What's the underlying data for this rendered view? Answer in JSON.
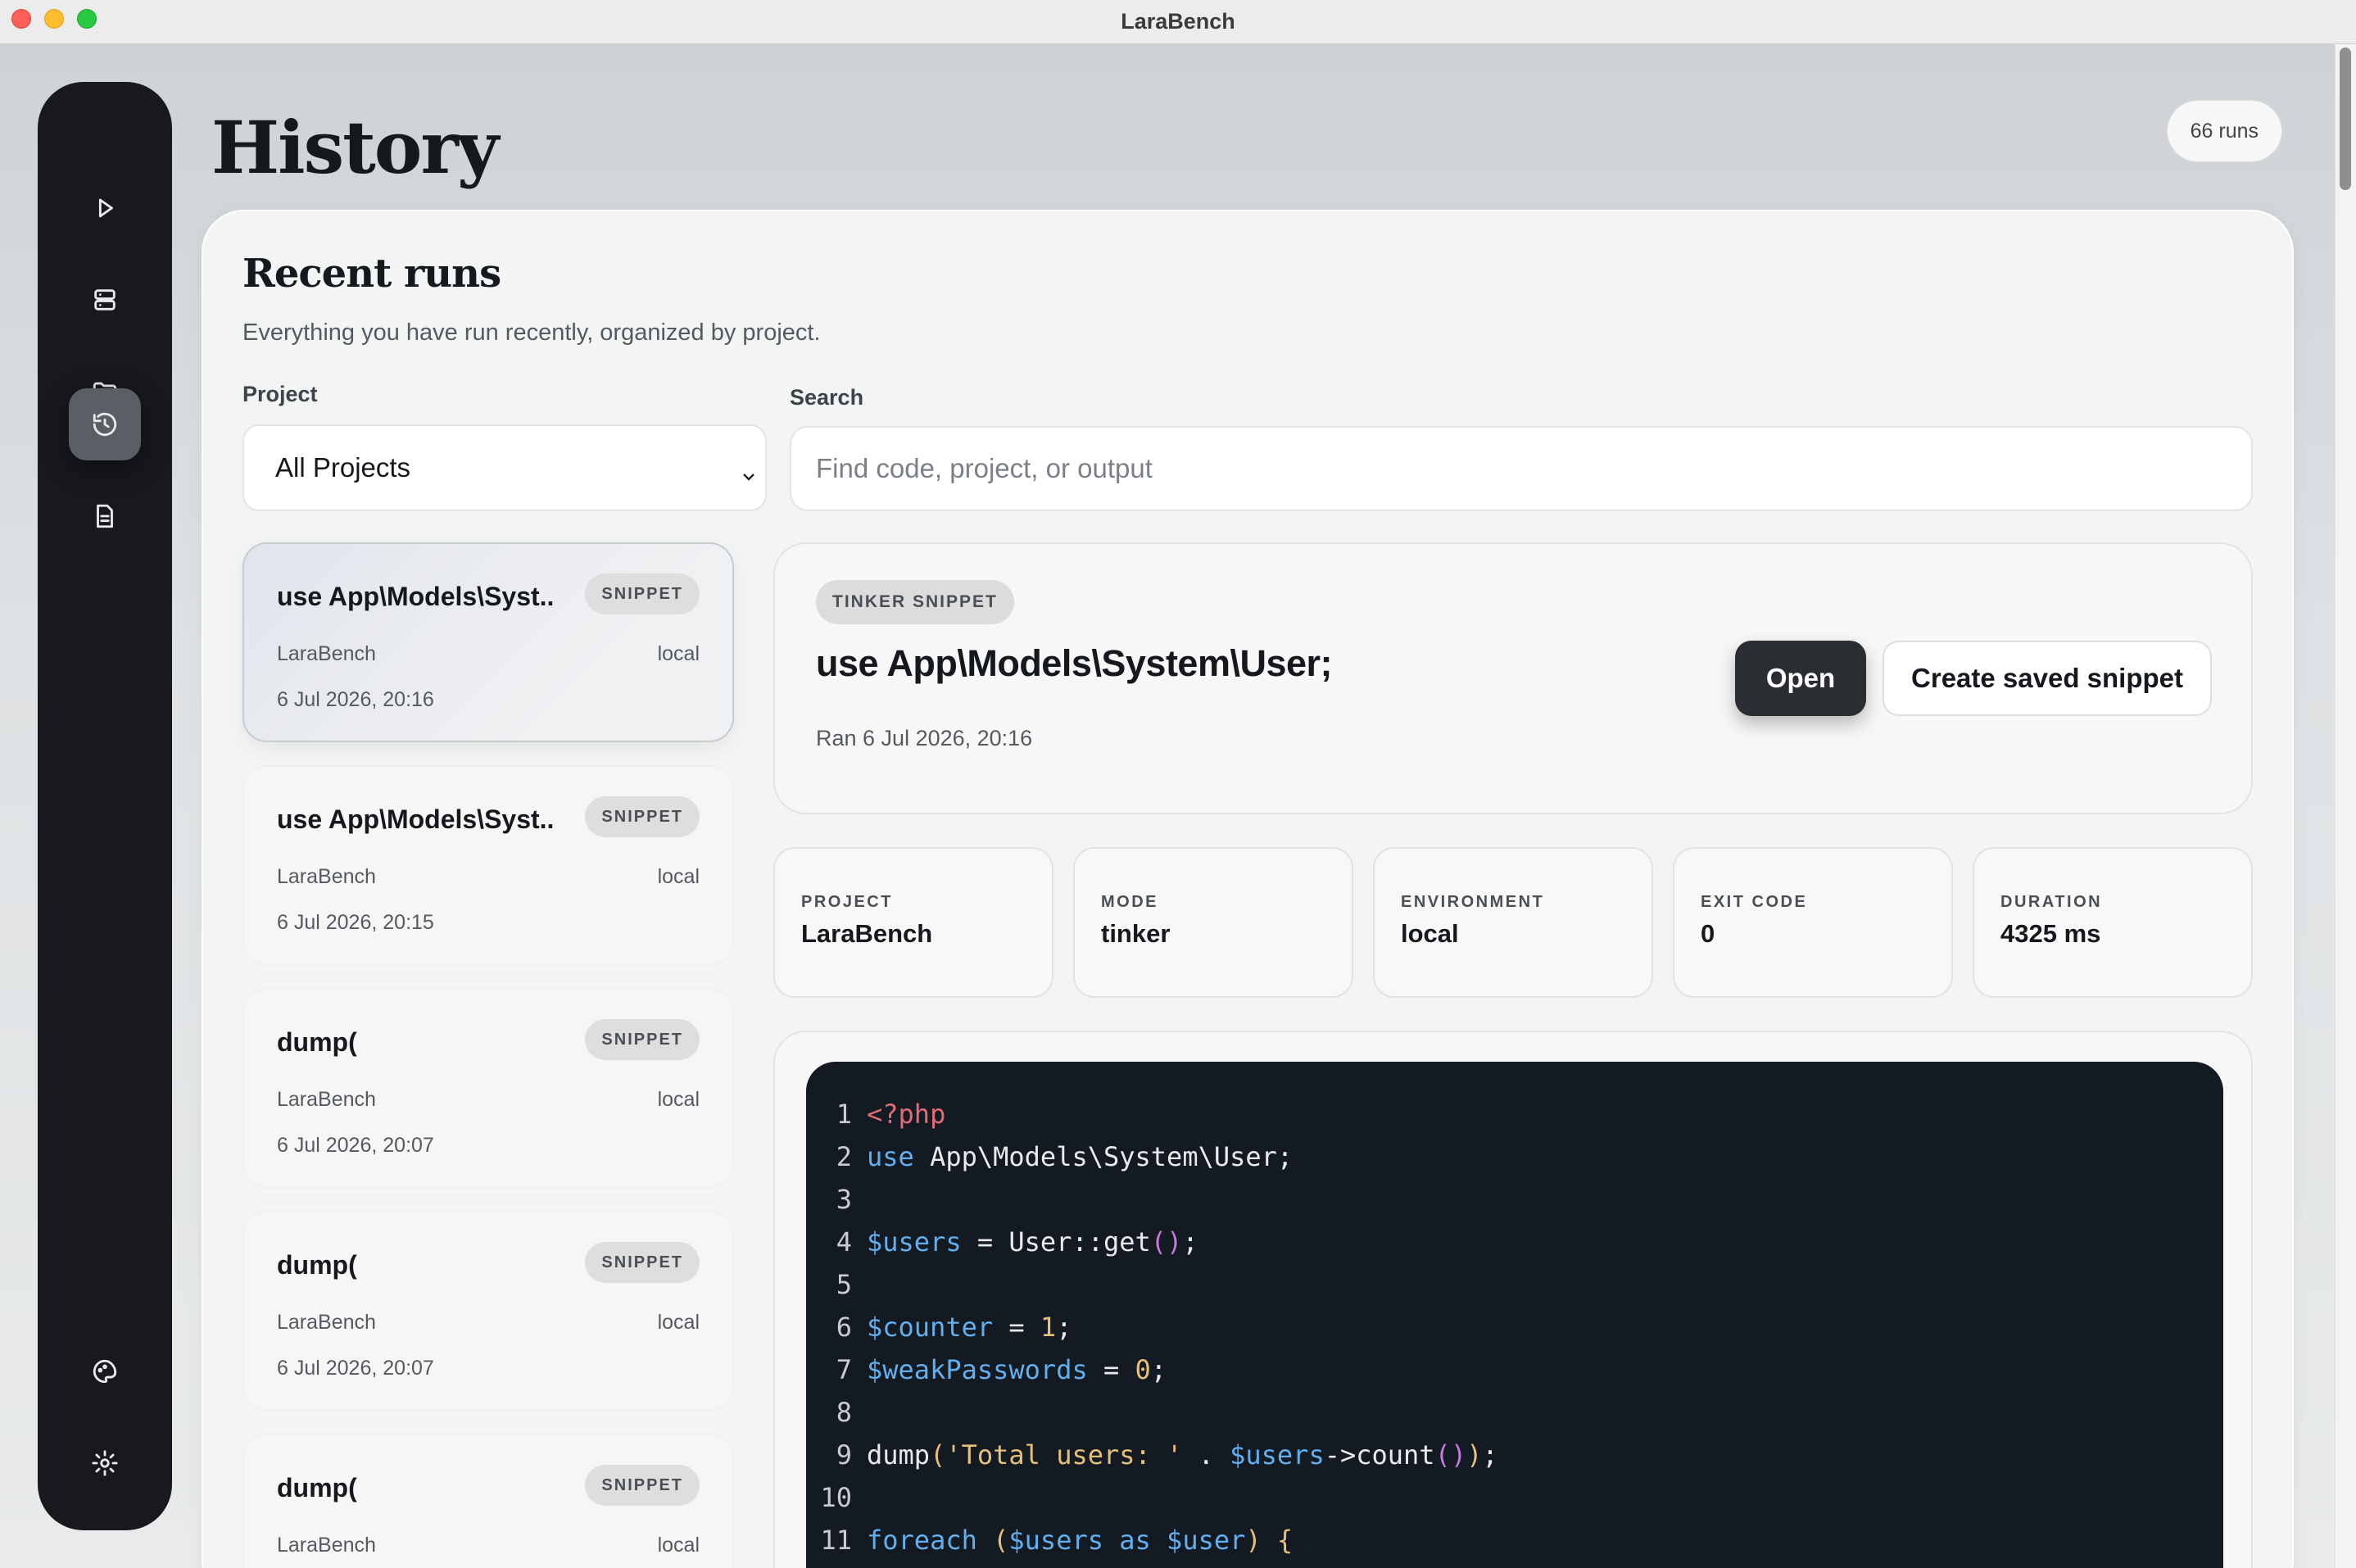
{
  "window": {
    "title": "LaraBench"
  },
  "sidebar": {
    "items": [
      {
        "name": "run",
        "icon": "play-icon"
      },
      {
        "name": "servers",
        "icon": "server-icon"
      },
      {
        "name": "projects",
        "icon": "folder-icon"
      },
      {
        "name": "history",
        "icon": "history-icon",
        "active": true
      },
      {
        "name": "snippets",
        "icon": "document-icon"
      },
      {
        "name": "appearance",
        "icon": "palette-icon"
      },
      {
        "name": "settings",
        "icon": "gear-icon"
      }
    ]
  },
  "header": {
    "title": "History",
    "runs_count": "66 runs"
  },
  "section": {
    "title": "Recent runs",
    "subtitle": "Everything you have run recently, organized by project."
  },
  "filters": {
    "project_label": "Project",
    "project_value": "All Projects",
    "search_label": "Search",
    "search_placeholder": "Find code, project, or output"
  },
  "runs": [
    {
      "title": "use App\\Models\\Syst...",
      "badge": "SNIPPET",
      "project": "LaraBench",
      "env": "local",
      "date": "6 Jul 2026, 20:16"
    },
    {
      "title": "use App\\Models\\Syst...",
      "badge": "SNIPPET",
      "project": "LaraBench",
      "env": "local",
      "date": "6 Jul 2026, 20:15"
    },
    {
      "title": "dump(",
      "badge": "SNIPPET",
      "project": "LaraBench",
      "env": "local",
      "date": "6 Jul 2026, 20:07"
    },
    {
      "title": "dump(",
      "badge": "SNIPPET",
      "project": "LaraBench",
      "env": "local",
      "date": "6 Jul 2026, 20:07"
    },
    {
      "title": "dump(",
      "badge": "SNIPPET",
      "project": "LaraBench",
      "env": "local",
      "date": ""
    }
  ],
  "detail": {
    "kind": "TINKER SNIPPET",
    "title": "use App\\Models\\System\\User;",
    "ran": "Ran 6 Jul 2026, 20:16",
    "open_label": "Open",
    "save_label": "Create saved snippet",
    "stats": [
      {
        "label": "PROJECT",
        "value": "LaraBench"
      },
      {
        "label": "MODE",
        "value": "tinker"
      },
      {
        "label": "ENVIRONMENT",
        "value": "local"
      },
      {
        "label": "EXIT CODE",
        "value": "0"
      },
      {
        "label": "DURATION",
        "value": "4325 ms"
      }
    ],
    "code_lines": [
      {
        "n": "1",
        "text": "<?php"
      },
      {
        "n": "2",
        "text": "use App\\Models\\System\\User;"
      },
      {
        "n": "3",
        "text": ""
      },
      {
        "n": "4",
        "text": "$users = User::get();"
      },
      {
        "n": "5",
        "text": ""
      },
      {
        "n": "6",
        "text": "$counter = 1;"
      },
      {
        "n": "7",
        "text": "$weakPasswords = 0;"
      },
      {
        "n": "8",
        "text": ""
      },
      {
        "n": "9",
        "text": "dump('Total users: ' . $users->count());"
      },
      {
        "n": "10",
        "text": ""
      },
      {
        "n": "11",
        "text": "foreach ($users as $user) {"
      }
    ]
  }
}
